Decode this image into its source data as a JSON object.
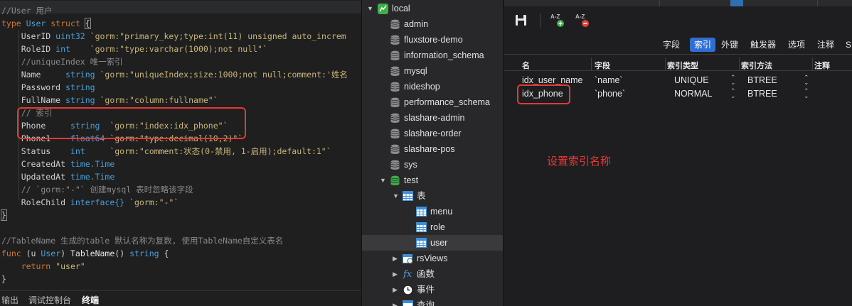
{
  "editor": {
    "lines": [
      [
        {
          "t": "//User 用户",
          "c": "com"
        }
      ],
      [
        {
          "t": "type ",
          "c": "kw"
        },
        {
          "t": "User ",
          "c": "type"
        },
        {
          "t": "struct ",
          "c": "kw"
        },
        {
          "t": "{",
          "c": "id",
          "box": true
        }
      ],
      [
        {
          "t": "    UserID ",
          "c": "fld"
        },
        {
          "t": "uint32 ",
          "c": "type"
        },
        {
          "t": "`gorm:\"primary_key;type:int(11) unsigned auto_increm",
          "c": "str"
        }
      ],
      [
        {
          "t": "    RoleID ",
          "c": "fld"
        },
        {
          "t": "int    ",
          "c": "type"
        },
        {
          "t": "`gorm:\"type:varchar(1000);not null\"`",
          "c": "str"
        }
      ],
      [
        {
          "t": "    //uniqueIndex 唯一索引",
          "c": "com"
        }
      ],
      [
        {
          "t": "    Name     ",
          "c": "fld"
        },
        {
          "t": "string ",
          "c": "type"
        },
        {
          "t": "`gorm:\"uniqueIndex;size:1000;not null;comment:'姓名",
          "c": "str"
        }
      ],
      [
        {
          "t": "    Password ",
          "c": "fld"
        },
        {
          "t": "string",
          "c": "type"
        }
      ],
      [
        {
          "t": "    FullName ",
          "c": "fld"
        },
        {
          "t": "string ",
          "c": "type"
        },
        {
          "t": "`gorm:\"column:fullname\"`",
          "c": "str"
        }
      ],
      [
        {
          "t": "    // 索引",
          "c": "com"
        }
      ],
      [
        {
          "t": "    Phone     ",
          "c": "fld"
        },
        {
          "t": "string  ",
          "c": "type"
        },
        {
          "t": "`gorm:\"index:idx_phone\"`",
          "c": "str"
        }
      ],
      [
        {
          "t": "    Phone1    ",
          "c": "fld"
        },
        {
          "t": "float64 ",
          "c": "type"
        },
        {
          "t": "`gorm:\"type:decimal(10,2)\"`",
          "c": "str"
        }
      ],
      [
        {
          "t": "    Status    ",
          "c": "fld"
        },
        {
          "t": "int     ",
          "c": "type"
        },
        {
          "t": "`gorm:\"comment:状态(0-禁用, 1-启用);default:1\"`",
          "c": "str"
        }
      ],
      [
        {
          "t": "    CreatedAt ",
          "c": "fld"
        },
        {
          "t": "time.Time",
          "c": "type"
        }
      ],
      [
        {
          "t": "    UpdatedAt ",
          "c": "fld"
        },
        {
          "t": "time.Time",
          "c": "type"
        }
      ],
      [
        {
          "t": "    // `gorm:\"-\"` 创建mysql 表时忽略该字段",
          "c": "com"
        }
      ],
      [
        {
          "t": "    RoleChild ",
          "c": "fld"
        },
        {
          "t": "interface{} ",
          "c": "type"
        },
        {
          "t": "`gorm:\"-\"`",
          "c": "str"
        }
      ],
      [
        {
          "t": "}",
          "c": "id",
          "box": true
        }
      ],
      [],
      [
        {
          "t": "//TableName 生成的table 默认名称为复数, 使用TableName自定义表名",
          "c": "com"
        }
      ],
      [
        {
          "t": "func ",
          "c": "kw"
        },
        {
          "t": "(u ",
          "c": "id"
        },
        {
          "t": "User",
          "c": "type"
        },
        {
          "t": ") ",
          "c": "id"
        },
        {
          "t": "TableName",
          "c": "fn"
        },
        {
          "t": "() ",
          "c": "id"
        },
        {
          "t": "string ",
          "c": "type"
        },
        {
          "t": "{",
          "c": "id"
        }
      ],
      [
        {
          "t": "    return ",
          "c": "kw"
        },
        {
          "t": "\"user\"",
          "c": "str"
        }
      ],
      [
        {
          "t": "}",
          "c": "id"
        }
      ]
    ],
    "bottom_tabs": [
      "输出",
      "调试控制台",
      "终端"
    ]
  },
  "sidebar": {
    "connection": "local",
    "databases": [
      "admin",
      "fluxstore-demo",
      "information_schema",
      "mysql",
      "nideshop",
      "performance_schema",
      "slashare-admin",
      "slashare-order",
      "slashare-pos",
      "sys",
      "test"
    ],
    "tables_group": "表",
    "tables": [
      "menu",
      "role",
      "user"
    ],
    "selected_table": "user",
    "more_groups": [
      "rsViews",
      "函数",
      "事件",
      "查询"
    ],
    "colors": {
      "db_icon": "#8d8d8d",
      "active_db_icon": "#3fae49",
      "table_icon": "#3d8fd8"
    }
  },
  "panel": {
    "tabs": [
      "字段",
      "索引",
      "外键",
      "触发器",
      "选项",
      "注释",
      "S"
    ],
    "active_tab": "索引",
    "columns": [
      "名",
      "字段",
      "索引类型",
      "索引方法",
      "注释"
    ],
    "rows": [
      {
        "name": "idx_user_name",
        "field": "`name`",
        "type": "UNIQUE",
        "method": "BTREE"
      },
      {
        "name": "idx_phone",
        "field": "`phone`",
        "type": "NORMAL",
        "method": "BTREE"
      }
    ],
    "annotation": "设置索引名称",
    "colors": {
      "accent": "#2f6fd4",
      "annotation": "#e53935"
    }
  }
}
